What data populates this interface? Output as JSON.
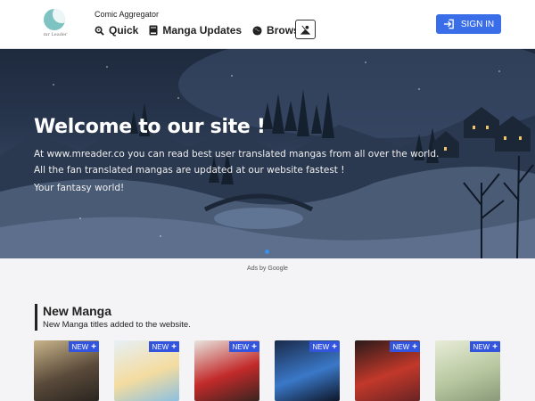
{
  "header": {
    "logo_text": "mr Leader",
    "tagline": "Comic Aggregator",
    "nav": [
      {
        "label": "Quick",
        "icon": "search-icon"
      },
      {
        "label": "Manga Updates",
        "icon": "book-icon"
      },
      {
        "label": "Browse",
        "icon": "globe-icon"
      }
    ],
    "theme_toggle_icon": "theme-icon",
    "signin_label": "SIGN IN",
    "signin_icon": "login-icon",
    "accent_color": "#3a6ee8"
  },
  "hero": {
    "title": "Welcome to our site !",
    "lines": [
      "At www.mreader.co you can read best user translated mangas from all over the world.",
      "All the fan translated mangas are updated at our website fastest !",
      "Your fantasy world!"
    ],
    "carousel_active_index": 0
  },
  "ads_label": "Ads by Google",
  "new_manga": {
    "title": "New Manga",
    "subtitle": "New Manga titles added to the website.",
    "badge_label": "NEW",
    "cards": [
      {
        "colors": [
          "#c8b48a",
          "#5a4a3a",
          "#2a2520"
        ]
      },
      {
        "colors": [
          "#e6f0f6",
          "#f4dca0",
          "#8cc0e0"
        ]
      },
      {
        "colors": [
          "#e8e4de",
          "#c22a2a",
          "#3a2420"
        ]
      },
      {
        "colors": [
          "#1a2a4a",
          "#3a78c8",
          "#0e1628"
        ]
      },
      {
        "colors": [
          "#2a1a1a",
          "#c2382a",
          "#6a2424"
        ]
      },
      {
        "colors": [
          "#e8ecd8",
          "#b8c8a0",
          "#8a9a7a"
        ]
      }
    ]
  }
}
